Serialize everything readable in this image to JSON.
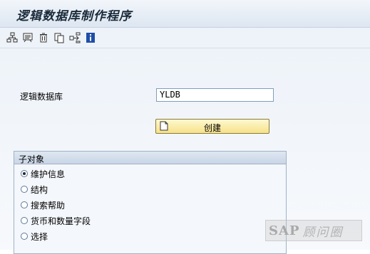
{
  "window": {
    "title": "逻辑数据库制作程序"
  },
  "toolbar": {
    "buttons": [
      {
        "icon": "hierarchy-icon"
      },
      {
        "icon": "display-change-icon"
      },
      {
        "icon": "delete-icon"
      },
      {
        "icon": "copy-icon"
      },
      {
        "icon": "where-used-icon"
      },
      {
        "icon": "information-icon"
      }
    ]
  },
  "form": {
    "logical_db_label": "逻辑数据库",
    "logical_db_value": "YLDB",
    "create_button": "创建"
  },
  "subobjects": {
    "title": "子对象",
    "options": [
      {
        "label": "维护信息",
        "checked": true
      },
      {
        "label": "结构",
        "checked": false
      },
      {
        "label": "搜索帮助",
        "checked": false
      },
      {
        "label": "货币和数量字段",
        "checked": false
      },
      {
        "label": "选择",
        "checked": false
      }
    ]
  },
  "watermark": {
    "brand": "SAP",
    "text": "顾问圈"
  },
  "colors": {
    "accent_blue": "#1f4ea8",
    "button_yellow": "#f6e28a"
  }
}
